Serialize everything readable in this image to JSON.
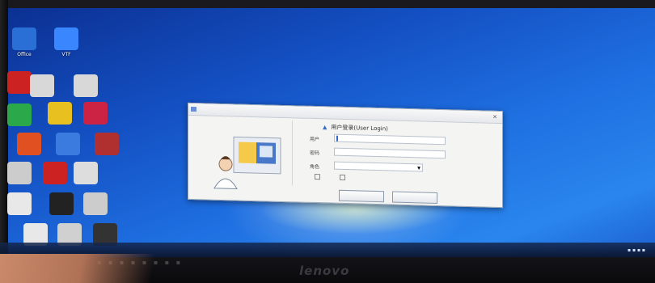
{
  "desktop": {
    "icons": [
      {
        "id": "i1",
        "label": "Office",
        "color": "#2a6fd6"
      },
      {
        "id": "i2",
        "label": "VTF",
        "color": "#3a86ff"
      },
      {
        "id": "i3",
        "label": "",
        "color": "#cc2222"
      },
      {
        "id": "i4",
        "label": "",
        "color": "#d8d8d8"
      },
      {
        "id": "i5",
        "label": "",
        "color": "#d8d8d8"
      },
      {
        "id": "i6",
        "label": "",
        "color": "#2aa84a"
      },
      {
        "id": "i7",
        "label": "",
        "color": "#e8c020"
      },
      {
        "id": "i8",
        "label": "",
        "color": "#cc2244"
      },
      {
        "id": "i9",
        "label": "",
        "color": "#e05020"
      },
      {
        "id": "i10",
        "label": "",
        "color": "#3b7be0"
      },
      {
        "id": "i11",
        "label": "",
        "color": "#b03030"
      },
      {
        "id": "i12",
        "label": "",
        "color": "#cccccc"
      },
      {
        "id": "i13",
        "label": "",
        "color": "#cc2222"
      },
      {
        "id": "i14",
        "label": "",
        "color": "#dddddd"
      },
      {
        "id": "i15",
        "label": "",
        "color": "#e8e8e8"
      },
      {
        "id": "i16",
        "label": "",
        "color": "#222222"
      },
      {
        "id": "i17",
        "label": "",
        "color": "#cccccc"
      },
      {
        "id": "i18",
        "label": "",
        "color": "#e8e8e8"
      },
      {
        "id": "i19",
        "label": "",
        "color": "#d0d0d0"
      },
      {
        "id": "i20",
        "label": "",
        "color": "#333333"
      }
    ]
  },
  "dialog": {
    "title": "",
    "left_hint": "",
    "heading": "用户登录(User Login)",
    "user_label": "用户",
    "user_value": "",
    "password_label": "密码",
    "role_label": "角色",
    "role_value": "",
    "remember_label": "",
    "usb_label": "",
    "link_text": "",
    "ok_label": "",
    "cancel_label": ""
  },
  "monitor": {
    "brand": "lenovo"
  },
  "colors": {
    "accent": "#3366cc",
    "desktop": "#1e6ee0"
  }
}
